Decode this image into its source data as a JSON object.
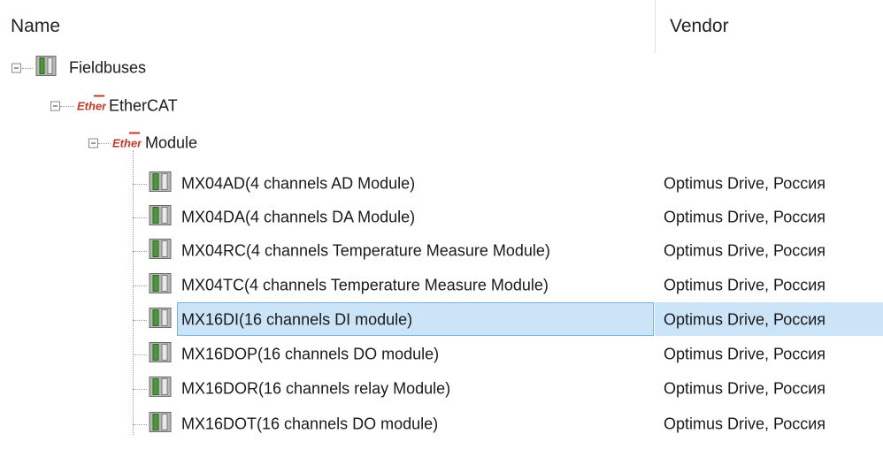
{
  "columns": {
    "name": "Name",
    "vendor": "Vendor"
  },
  "tree": {
    "root": {
      "label": "Fieldbuses",
      "icon": "device-module-icon"
    },
    "ethercat": {
      "label": "EtherCAT",
      "icon": "ethercat-icon"
    },
    "module": {
      "label": "Module",
      "icon": "ethercat-icon"
    },
    "items": [
      {
        "label": "MX04AD(4 channels AD Module)",
        "vendor": "Optimus Drive, Россия"
      },
      {
        "label": "MX04DA(4 channels DA Module)",
        "vendor": "Optimus Drive, Россия"
      },
      {
        "label": "MX04RC(4 channels Temperature Measure Module)",
        "vendor": "Optimus Drive, Россия"
      },
      {
        "label": "MX04TC(4 channels Temperature Measure Module)",
        "vendor": "Optimus Drive, Россия"
      },
      {
        "label": "MX16DI(16 channels DI module)",
        "vendor": "Optimus Drive, Россия",
        "selected": true
      },
      {
        "label": "MX16DOP(16 channels DO module)",
        "vendor": "Optimus Drive, Россия"
      },
      {
        "label": "MX16DOR(16 channels relay Module)",
        "vendor": "Optimus Drive, Россия"
      },
      {
        "label": "MX16DOT(16 channels DO module)",
        "vendor": "Optimus Drive, Россия"
      }
    ]
  },
  "colors": {
    "selection": "#cce4f7",
    "selection_border": "#7ab0dc"
  }
}
